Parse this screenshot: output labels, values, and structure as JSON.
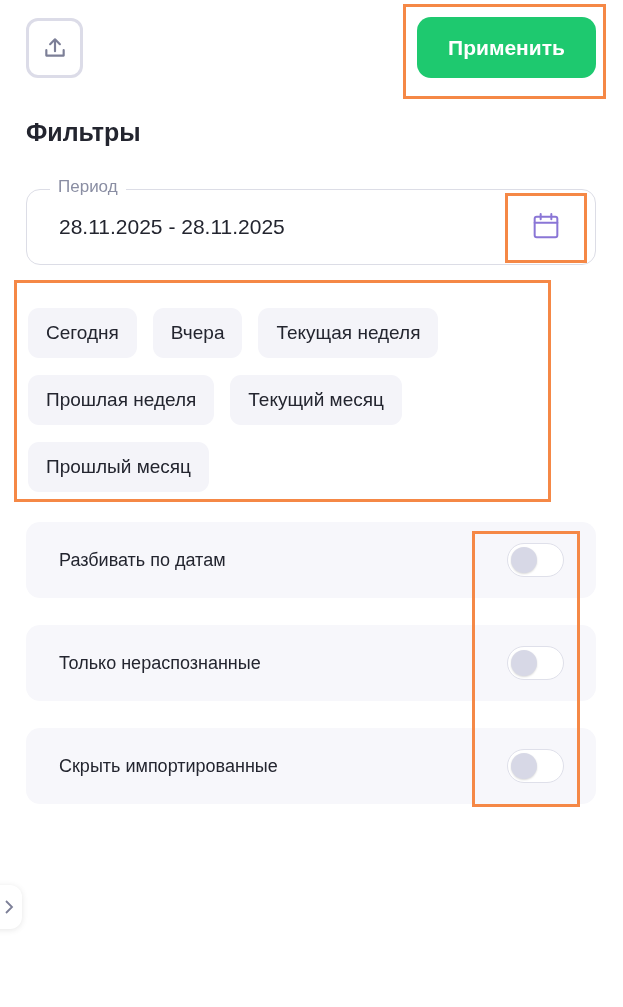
{
  "toolbar": {
    "apply_button": {
      "label": "Применить",
      "highlighted": true
    }
  },
  "title": "Фильтры",
  "period": {
    "label": "Период",
    "value": "28.11.2025 - 28.11.2025",
    "calendar_highlighted": true
  },
  "presets": {
    "highlighted": true,
    "items": [
      {
        "label": "Сегодня"
      },
      {
        "label": "Вчера"
      },
      {
        "label": "Текущая неделя"
      },
      {
        "label": "Прошлая неделя"
      },
      {
        "label": "Текущий месяц"
      },
      {
        "label": "Прошлый месяц"
      }
    ]
  },
  "options": {
    "toggles_highlighted": true,
    "items": [
      {
        "label": "Разбивать по датам",
        "on": false
      },
      {
        "label": "Только нераспознанные",
        "on": false
      },
      {
        "label": "Скрыть импортированные",
        "on": false
      }
    ]
  }
}
